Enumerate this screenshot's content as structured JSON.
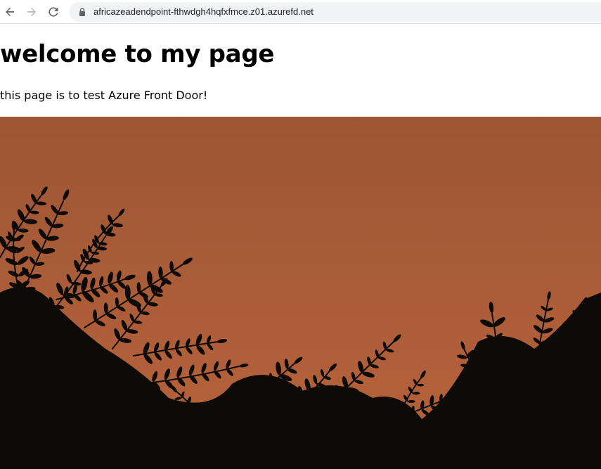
{
  "browser": {
    "url": "africazeadendpoint-fthwdgh4hqfxfmce.z01.azurefd.net",
    "icons": [
      "back-arrow-icon",
      "forward-arrow-icon",
      "reload-icon",
      "lock-icon"
    ]
  },
  "page": {
    "heading": "welcome to my page",
    "paragraph": "this page is to test Azure Front Door!"
  },
  "hero": {
    "sky_top_color": "#9d5634",
    "sky_bottom_color": "#b8633c",
    "foliage_color": "#0e0a08"
  }
}
